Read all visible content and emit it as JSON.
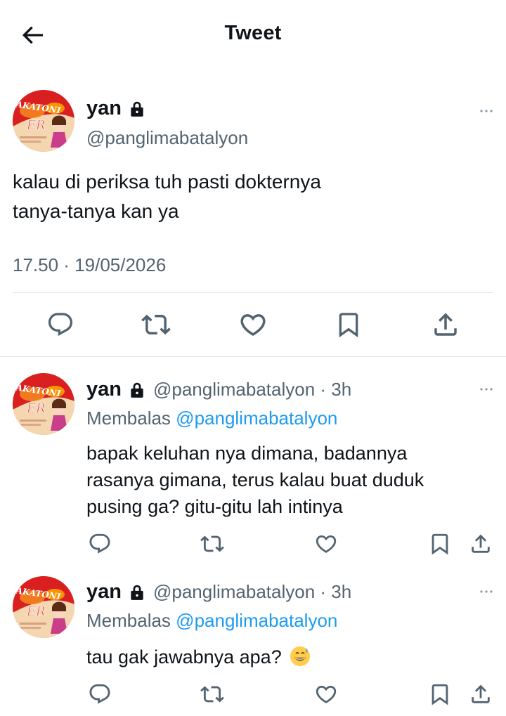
{
  "header": {
    "title": "Tweet"
  },
  "main_tweet": {
    "name": "yan",
    "handle": "@panglimabatalyon",
    "text_line1": "kalau di periksa tuh pasti dokternya",
    "text_line2": "tanya-tanya kan ya",
    "timestamp": "17.50 · 19/05/2026"
  },
  "replies": [
    {
      "name": "yan",
      "handle_time": "@panglimabatalyon · 3h",
      "reply_prefix": "Membalas",
      "mention": "@panglimabatalyon",
      "text_line1": "bapak keluhan nya dimana, badannya",
      "text_line2": "rasanya gimana, terus kalau buat duduk",
      "text_line3": "pusing ga? gitu-gitu lah intinya"
    },
    {
      "name": "yan",
      "handle_time": "@panglimabatalyon · 3h",
      "reply_prefix": "Membalas",
      "mention": "@panglimabatalyon",
      "text_line1": "tau gak jawabnya apa?",
      "emoji": "grinning-sweat-emoji"
    }
  ],
  "avatar_text": "AKATONI",
  "icons": [
    "back-arrow-icon",
    "lock-icon",
    "more-icon",
    "reply-icon",
    "retweet-icon",
    "like-icon",
    "bookmark-icon",
    "share-icon"
  ],
  "colors": {
    "text": "#0f1419",
    "secondary": "#536471",
    "accent": "#1d9bf0",
    "divider": "#e1e8ed"
  }
}
